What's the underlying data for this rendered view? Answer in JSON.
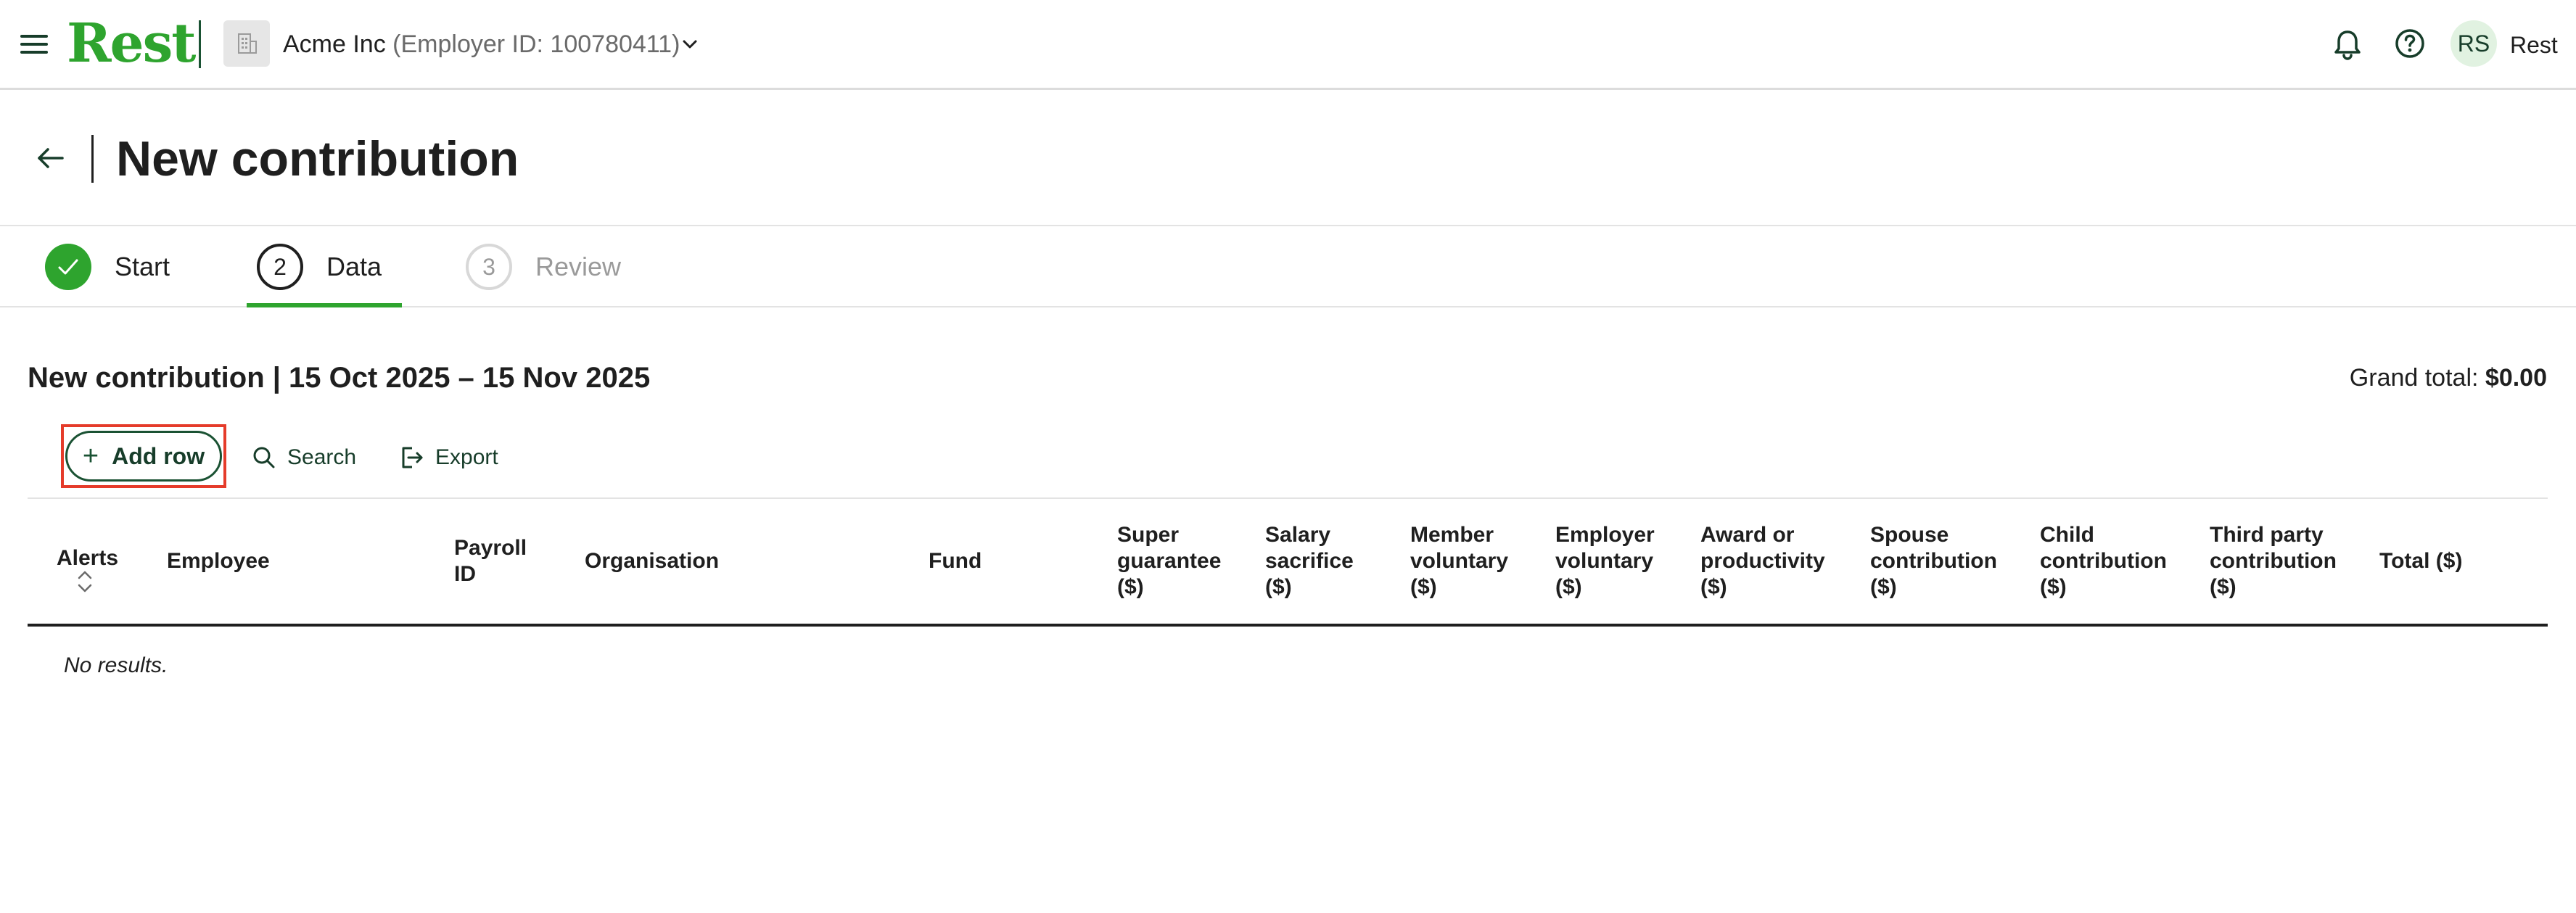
{
  "header": {
    "logo": "Rest",
    "org_name": "Acme Inc",
    "org_id": "(Employer ID: 100780411)",
    "avatar_initials": "RS",
    "user_name": "Rest"
  },
  "page": {
    "title": "New contribution"
  },
  "stepper": {
    "steps": [
      {
        "label": "Start",
        "number": "",
        "status": "done"
      },
      {
        "label": "Data",
        "number": "2",
        "status": "active"
      },
      {
        "label": "Review",
        "number": "3",
        "status": "pending"
      }
    ]
  },
  "section": {
    "title": "New contribution | 15 Oct 2025 – 15 Nov 2025",
    "grand_total_label": "Grand total:",
    "grand_total_value": "$0.00"
  },
  "toolbar": {
    "add_row_label": "Add row",
    "search_label": "Search",
    "export_label": "Export"
  },
  "table": {
    "columns": [
      "Alerts",
      "Employee",
      "Payroll\nID",
      "Organisation",
      "Fund",
      "Super\nguarantee\n($)",
      "Salary\nsacrifice\n($)",
      "Member\nvoluntary\n($)",
      "Employer\nvoluntary\n($)",
      "Award or\nproductivity\n($)",
      "Spouse\ncontribution\n($)",
      "Child\ncontribution\n($)",
      "Third party\ncontribution\n($)",
      "Total ($)"
    ],
    "empty_message": "No results."
  },
  "colors": {
    "brand_green": "#2ea42e",
    "dark_green": "#173d2a",
    "highlight_red": "#e53b2a"
  }
}
